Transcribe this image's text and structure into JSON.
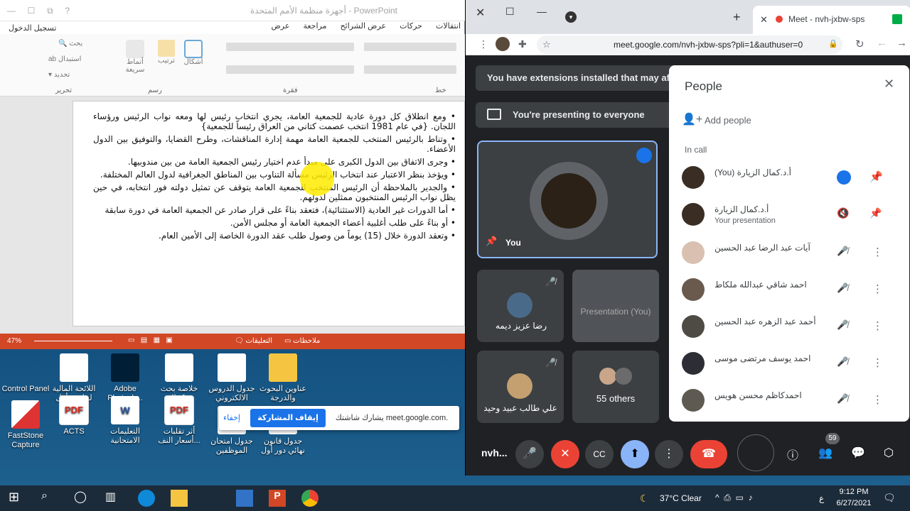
{
  "powerpoint": {
    "title": "أجهزة منظمة الأمم المتحدة  -  PowerPoint",
    "signin": "تسجيل الدخول",
    "tabs": [
      "انتقالات",
      "حركات",
      "عرض الشرائح",
      "مراجعة",
      "عرض"
    ],
    "ribbon": {
      "search": "بحث",
      "replace": "استبدال",
      "select": "تحديد",
      "edit_group": "تحرير",
      "styles": "أنماط سريعة",
      "arrange": "ترتيب",
      "shapes": "أشكال",
      "draw_group": "رسم",
      "paragraph_group": "فقرة",
      "font_group": "خط"
    },
    "bullets": [
      "ومع انطلاق كل دورة عادية للجمعية العامة، يجري انتخاب رئيس لها ومعه نواب الرئيس ورؤساء اللجان. {في عام 1981 انتخب عصمت كتاني من العراق رئيساً للجمعية}",
      "وتناط بالرئيس المنتخب للجمعية العامة مهمة إدارة المناقشات، وطرح القضايا، والتوفيق بين الدول الأعضاء.",
      "وجرى الاتفاق بين الدول الكبرى على مبدأ عدم اختيار رئيس الجمعية العامة من بين مندوبيها.",
      "ويؤخذ بنظر الاعتبار عند انتخاب الرئيس مسألة التناوب بين المناطق الجغرافية لدول العالم المختلفة.",
      "والجدير بالملاحظة أن الرئيس المنتخب للجمعية العامة يتوقف عن تمثيل دولته فور انتخابه، في حين يظل نواب الرئيس المنتخبون ممثلين لدولهم.",
      "أما الدورات غير العادية (الاستثنائية)، فتعقد بناءً على قرار صادر عن الجمعية العامة في دورة سابقة",
      "أو بناءً على طلب أغلبية أعضاء الجمعية العامة أو مجلس الأمن.",
      "وتعقد الدورة خلال (15) يوماً من وصول طلب عقد الدورة الخاصة إلى الأمين العام."
    ],
    "status": {
      "notes": "ملاحظات",
      "comments": "التعليقات",
      "zoom": "47%"
    }
  },
  "desktop_icons": [
    {
      "label": "عناوين البحوث والدرجة"
    },
    {
      "label": "جدول الدروس الالكتروني"
    },
    {
      "label": "خلاصة بحث د.كمال"
    },
    {
      "label": "Adobe Photosh..."
    },
    {
      "label": "اللائحة المالية لجامعة أهل"
    },
    {
      "label": "Control Panel"
    },
    {
      "label": "جدول قانون نهائي دور أول"
    },
    {
      "label": "جدول امتحان الموظفين"
    },
    {
      "label": "أثر تقلبات أسعار النف..."
    },
    {
      "label": "التعليمات الامتحانية"
    },
    {
      "label": "ACTS"
    },
    {
      "label": "FastStone Capture"
    }
  ],
  "share_bar": {
    "text": "يشارك شاشتك meet.google.com.",
    "stop": "إيقاف المشاركة",
    "hide": "إخفاء"
  },
  "chrome": {
    "tab_title": "Meet - nvh-jxbw-sps",
    "url": "meet.google.com/nvh-jxbw-sps?pli=1&authuser=0"
  },
  "meet": {
    "ext_banner": "You have extensions installed that may af",
    "presenting_banner": "You're presenting to everyone",
    "you_label": "You",
    "presentation_tile": "Presentation (You)",
    "tiles": [
      {
        "name": "رضا عزيز ديمه"
      },
      {
        "name": "علي طالب عبيد وحيد"
      }
    ],
    "others": "55 others",
    "meeting_code": "nvh...",
    "participants_badge": "59",
    "people": {
      "title": "People",
      "add": "Add people",
      "in_call": "In call",
      "rows": [
        {
          "name": "أ.د.كمال الزيارة (You)",
          "sub": ""
        },
        {
          "name": "أ.د.كمال الزيارة",
          "sub": "Your presentation"
        },
        {
          "name": "آيات عبد الرضا عبد الحسين",
          "sub": ""
        },
        {
          "name": "احمد شاقي عبدالله ملكاط",
          "sub": ""
        },
        {
          "name": "أحمد عبد الزهره عبد الحسين",
          "sub": ""
        },
        {
          "name": "احمد يوسف مرتضى موسى",
          "sub": ""
        },
        {
          "name": "احمدكاظم محسن هويس",
          "sub": ""
        }
      ]
    }
  },
  "taskbar": {
    "weather": "37°C Clear",
    "lang": "ع",
    "time": "9:12 PM",
    "date": "6/27/2021"
  },
  "colors": {
    "ppt_accent": "#d24726",
    "meet_red": "#ea4335",
    "meet_blue": "#8ab4f8",
    "share_blue": "#1a73e8"
  }
}
